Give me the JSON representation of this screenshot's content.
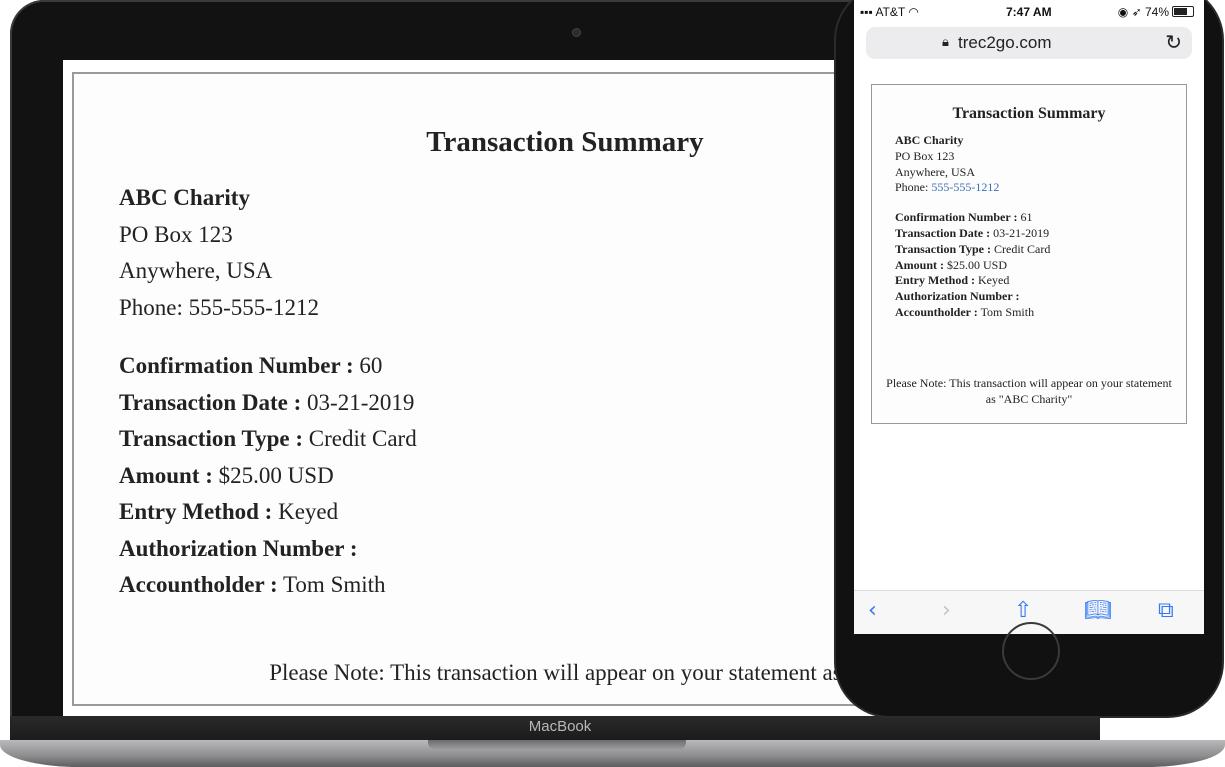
{
  "laptop": {
    "brand": "MacBook",
    "doc": {
      "title": "Transaction Summary",
      "org_name": "ABC Charity",
      "address1": "PO Box 123",
      "address2": "Anywhere, USA",
      "phone": "Phone: 555-555-1212",
      "fields": [
        {
          "label": "Confirmation Number :",
          "value": " 60"
        },
        {
          "label": "Transaction Date :",
          "value": " 03-21-2019"
        },
        {
          "label": "Transaction Type :",
          "value": " Credit Card"
        },
        {
          "label": "Amount :",
          "value": " $25.00 USD"
        },
        {
          "label": "Entry Method :",
          "value": " Keyed"
        },
        {
          "label": "Authorization Number :",
          "value": ""
        },
        {
          "label": "Accountholder :",
          "value": " Tom Smith"
        }
      ],
      "note": "Please Note: This transaction will appear on your statement as \"AB"
    }
  },
  "phone": {
    "status": {
      "carrier": "AT&T",
      "time": "7:47 AM",
      "battery": "74%"
    },
    "url": "trec2go.com",
    "doc": {
      "title": "Transaction Summary",
      "org_name": "ABC Charity",
      "address1": "PO Box 123",
      "address2": "Anywhere, USA",
      "phone_label": "Phone: ",
      "phone_number": "555-555-1212",
      "fields": [
        {
          "label": "Confirmation Number :",
          "value": " 61"
        },
        {
          "label": "Transaction Date :",
          "value": " 03-21-2019"
        },
        {
          "label": "Transaction Type :",
          "value": " Credit Card"
        },
        {
          "label": "Amount :",
          "value": " $25.00 USD"
        },
        {
          "label": "Entry Method :",
          "value": " Keyed"
        },
        {
          "label": "Authorization Number :",
          "value": ""
        },
        {
          "label": "Accountholder :",
          "value": " Tom Smith"
        }
      ],
      "note": "Please Note: This transaction will appear on your statement as \"ABC Charity\""
    },
    "toolbar": {
      "back_icon": "chevron-left-icon",
      "forward_icon": "chevron-right-icon",
      "share_icon": "share-icon",
      "bookmarks_icon": "book-icon",
      "tabs_icon": "tabs-icon"
    },
    "colors": {
      "link": "#3a70b8",
      "accent": "#3478f6"
    }
  }
}
